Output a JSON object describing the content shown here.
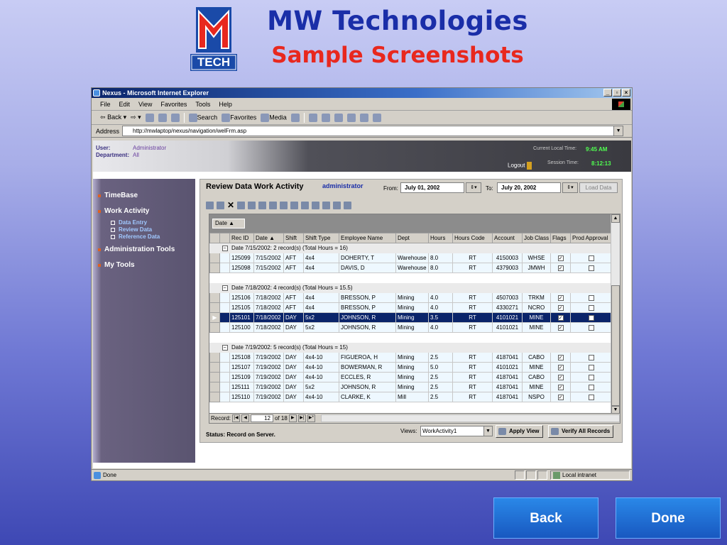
{
  "slide": {
    "title": "MW Technologies",
    "subtitle": "Sample Screenshots",
    "logo_text": "TECH",
    "back_label": "Back",
    "done_label": "Done"
  },
  "browser": {
    "window_title": "Nexus - Microsoft Internet Explorer",
    "menu": [
      "File",
      "Edit",
      "View",
      "Favorites",
      "Tools",
      "Help"
    ],
    "toolbar": {
      "back": "Back",
      "search": "Search",
      "favorites": "Favorites",
      "media": "Media"
    },
    "address_label": "Address",
    "address_url": "http://mwlaptop/nexus/navigation/welFrm.asp",
    "status_text": "Done",
    "zone_text": "Local intranet"
  },
  "app_header": {
    "user_label": "User:",
    "user_value": "Administrator",
    "department_label": "Department:",
    "department_value": "All",
    "current_time_label": "Current Local Time:",
    "current_time_value": "9:45 AM",
    "session_time_label": "Session Time:",
    "session_time_value": "8:12:13",
    "logout_label": "Logout"
  },
  "nav": {
    "items": [
      "TimeBase",
      "Work Activity",
      "Administration Tools",
      "My Tools"
    ],
    "sub_items": [
      "Data Entry",
      "Review Data",
      "Reference Data"
    ]
  },
  "panel": {
    "title": "Review Data Work Activity",
    "user": "administrator",
    "from_label": "From:",
    "from_date": "July 01, 2002",
    "to_label": "To:",
    "to_date": "July 20, 2002",
    "load_label": "Load Data",
    "group_chip": "Date",
    "status": "Status: Record on Server.",
    "views_label": "Views:",
    "views_value": "WorkActivity1",
    "apply_label": "Apply View",
    "verify_label": "Verify All Records",
    "record_label": "Record:",
    "record_current": "12",
    "record_of": "of 18"
  },
  "grid": {
    "columns": [
      "Rec ID",
      "Date",
      "Shift",
      "Shift Type",
      "Employee Name",
      "Dept",
      "Hours",
      "Hours Code",
      "Account",
      "Job Class",
      "Flags",
      "Prod Approval"
    ],
    "groups": [
      {
        "header": "Date 7/15/2002:  2 record(s)  (Total Hours = 16)",
        "rows": [
          {
            "rec": "125099",
            "date": "7/15/2002",
            "shift": "AFT",
            "type": "4x4",
            "emp": "DOHERTY, T",
            "dept": "Warehouse",
            "hours": "8.0",
            "code": "RT",
            "acct": "4150003",
            "job": "WHSE",
            "flag": true,
            "appr": false
          },
          {
            "rec": "125098",
            "date": "7/15/2002",
            "shift": "AFT",
            "type": "4x4",
            "emp": "DAVIS, D",
            "dept": "Warehouse",
            "hours": "8.0",
            "code": "RT",
            "acct": "4379003",
            "job": "JMWH",
            "flag": true,
            "appr": false
          }
        ]
      },
      {
        "header": "Date 7/18/2002:  4 record(s)  (Total Hours = 15.5)",
        "rows": [
          {
            "rec": "125106",
            "date": "7/18/2002",
            "shift": "AFT",
            "type": "4x4",
            "emp": "BRESSON, P",
            "dept": "Mining",
            "hours": "4.0",
            "code": "RT",
            "acct": "4507003",
            "job": "TRKM",
            "flag": true,
            "appr": false
          },
          {
            "rec": "125105",
            "date": "7/18/2002",
            "shift": "AFT",
            "type": "4x4",
            "emp": "BRESSON, P",
            "dept": "Mining",
            "hours": "4.0",
            "code": "RT",
            "acct": "4330271",
            "job": "NCRO",
            "flag": true,
            "appr": false
          },
          {
            "rec": "125101",
            "date": "7/18/2002",
            "shift": "DAY",
            "type": "5x2",
            "emp": "JOHNSON, R",
            "dept": "Mining",
            "hours": "3.5",
            "code": "RT",
            "acct": "4101021",
            "job": "MINE",
            "flag": true,
            "appr": false,
            "selected": true
          },
          {
            "rec": "125100",
            "date": "7/18/2002",
            "shift": "DAY",
            "type": "5x2",
            "emp": "JOHNSON, R",
            "dept": "Mining",
            "hours": "4.0",
            "code": "RT",
            "acct": "4101021",
            "job": "MINE",
            "flag": true,
            "appr": false
          }
        ]
      },
      {
        "header": "Date 7/19/2002:  5 record(s)  (Total Hours = 15)",
        "rows": [
          {
            "rec": "125108",
            "date": "7/19/2002",
            "shift": "DAY",
            "type": "4x4-10",
            "emp": "FIGUEROA, H",
            "dept": "Mining",
            "hours": "2.5",
            "code": "RT",
            "acct": "4187041",
            "job": "CABO",
            "flag": true,
            "appr": false
          },
          {
            "rec": "125107",
            "date": "7/19/2002",
            "shift": "DAY",
            "type": "4x4-10",
            "emp": "BOWERMAN, R",
            "dept": "Mining",
            "hours": "5.0",
            "code": "RT",
            "acct": "4101021",
            "job": "MINE",
            "flag": true,
            "appr": false
          },
          {
            "rec": "125109",
            "date": "7/19/2002",
            "shift": "DAY",
            "type": "4x4-10",
            "emp": "ECCLES, R",
            "dept": "Mining",
            "hours": "2.5",
            "code": "RT",
            "acct": "4187041",
            "job": "CABO",
            "flag": true,
            "appr": false
          },
          {
            "rec": "125111",
            "date": "7/19/2002",
            "shift": "DAY",
            "type": "5x2",
            "emp": "JOHNSON, R",
            "dept": "Mining",
            "hours": "2.5",
            "code": "RT",
            "acct": "4187041",
            "job": "MINE",
            "flag": true,
            "appr": false
          },
          {
            "rec": "125110",
            "date": "7/19/2002",
            "shift": "DAY",
            "type": "4x4-10",
            "emp": "CLARKE, K",
            "dept": "Mill",
            "hours": "2.5",
            "code": "RT",
            "acct": "4187041",
            "job": "NSPO",
            "flag": true,
            "appr": false
          }
        ]
      }
    ]
  }
}
